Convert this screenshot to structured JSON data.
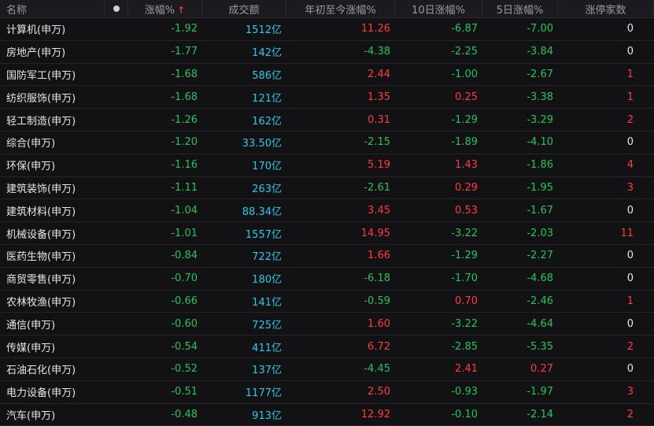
{
  "header": {
    "name": "名称",
    "change": "涨幅%",
    "sort_arrow": "↑",
    "volume": "成交额",
    "ytd": "年初至今涨幅%",
    "d10": "10日涨幅%",
    "d5": "5日涨幅%",
    "limit_up": "涨停家数"
  },
  "colors": {
    "up": "#ff3b3b",
    "down": "#22c35e",
    "volume": "#2bc7e6"
  },
  "rows": [
    {
      "name": "计算机(申万)",
      "change": "-1.92",
      "volume": "1512亿",
      "ytd": "11.26",
      "d10": "-6.87",
      "d5": "-7.00",
      "limit": "0"
    },
    {
      "name": "房地产(申万)",
      "change": "-1.77",
      "volume": "142亿",
      "ytd": "-4.38",
      "d10": "-2.25",
      "d5": "-3.84",
      "limit": "0"
    },
    {
      "name": "国防军工(申万)",
      "change": "-1.68",
      "volume": "586亿",
      "ytd": "2.44",
      "d10": "-1.00",
      "d5": "-2.67",
      "limit": "1"
    },
    {
      "name": "纺织服饰(申万)",
      "change": "-1.68",
      "volume": "121亿",
      "ytd": "1.35",
      "d10": "0.25",
      "d5": "-3.38",
      "limit": "1"
    },
    {
      "name": "轻工制造(申万)",
      "change": "-1.26",
      "volume": "162亿",
      "ytd": "0.31",
      "d10": "-1.29",
      "d5": "-3.29",
      "limit": "2"
    },
    {
      "name": "综合(申万)",
      "change": "-1.20",
      "volume": "33.50亿",
      "ytd": "-2.15",
      "d10": "-1.89",
      "d5": "-4.10",
      "limit": "0"
    },
    {
      "name": "环保(申万)",
      "change": "-1.16",
      "volume": "170亿",
      "ytd": "5.19",
      "d10": "1.43",
      "d5": "-1.86",
      "limit": "4"
    },
    {
      "name": "建筑装饰(申万)",
      "change": "-1.11",
      "volume": "263亿",
      "ytd": "-2.61",
      "d10": "0.29",
      "d5": "-1.95",
      "limit": "3"
    },
    {
      "name": "建筑材料(申万)",
      "change": "-1.04",
      "volume": "88.34亿",
      "ytd": "3.45",
      "d10": "0.53",
      "d5": "-1.67",
      "limit": "0"
    },
    {
      "name": "机械设备(申万)",
      "change": "-1.01",
      "volume": "1557亿",
      "ytd": "14.95",
      "d10": "-3.22",
      "d5": "-2.03",
      "limit": "11"
    },
    {
      "name": "医药生物(申万)",
      "change": "-0.84",
      "volume": "722亿",
      "ytd": "1.66",
      "d10": "-1.29",
      "d5": "-2.27",
      "limit": "0"
    },
    {
      "name": "商贸零售(申万)",
      "change": "-0.70",
      "volume": "180亿",
      "ytd": "-6.18",
      "d10": "-1.70",
      "d5": "-4.68",
      "limit": "0"
    },
    {
      "name": "农林牧渔(申万)",
      "change": "-0.66",
      "volume": "141亿",
      "ytd": "-0.59",
      "d10": "0.70",
      "d5": "-2.46",
      "limit": "1"
    },
    {
      "name": "通信(申万)",
      "change": "-0.60",
      "volume": "725亿",
      "ytd": "1.60",
      "d10": "-3.22",
      "d5": "-4.64",
      "limit": "0"
    },
    {
      "name": "传媒(申万)",
      "change": "-0.54",
      "volume": "411亿",
      "ytd": "6.72",
      "d10": "-2.85",
      "d5": "-5.35",
      "limit": "2"
    },
    {
      "name": "石油石化(申万)",
      "change": "-0.52",
      "volume": "137亿",
      "ytd": "-4.45",
      "d10": "2.41",
      "d5": "0.27",
      "limit": "0"
    },
    {
      "name": "电力设备(申万)",
      "change": "-0.51",
      "volume": "1177亿",
      "ytd": "2.50",
      "d10": "-0.93",
      "d5": "-1.97",
      "limit": "3"
    },
    {
      "name": "汽车(申万)",
      "change": "-0.48",
      "volume": "913亿",
      "ytd": "12.92",
      "d10": "-0.10",
      "d5": "-2.14",
      "limit": "2"
    }
  ]
}
